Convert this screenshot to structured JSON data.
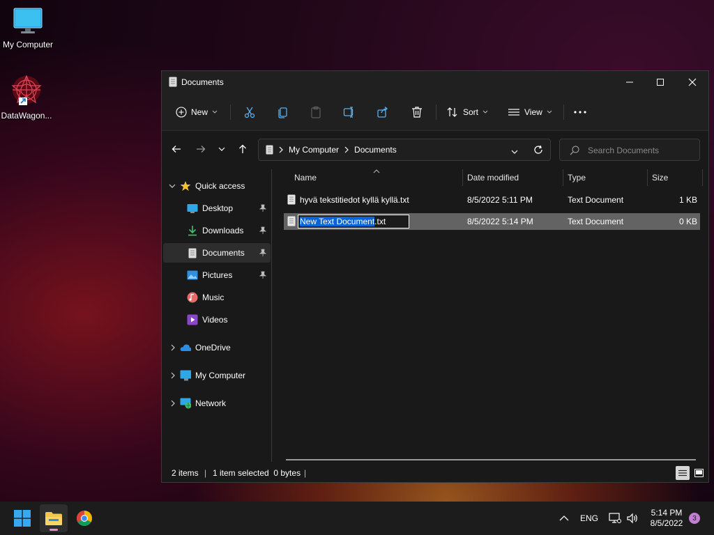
{
  "desktop": {
    "icons": [
      {
        "label": "My Computer",
        "icon": "monitor-icon"
      },
      {
        "label": "DataWagon...",
        "icon": "datawagon-shortcut-icon"
      }
    ]
  },
  "window": {
    "title": "Documents",
    "toolbar": {
      "new_label": "New",
      "sort_label": "Sort",
      "view_label": "View"
    },
    "address": {
      "crumbs": [
        "My Computer",
        "Documents"
      ]
    },
    "search": {
      "placeholder": "Search Documents"
    },
    "sidebar": {
      "quick_access": "Quick access",
      "items": [
        {
          "label": "Desktop",
          "pinned": true
        },
        {
          "label": "Downloads",
          "pinned": true
        },
        {
          "label": "Documents",
          "pinned": true,
          "selected": true
        },
        {
          "label": "Pictures",
          "pinned": true
        },
        {
          "label": "Music",
          "pinned": false
        },
        {
          "label": "Videos",
          "pinned": false
        }
      ],
      "roots": [
        "OneDrive",
        "My Computer",
        "Network"
      ]
    },
    "columns": [
      "Name",
      "Date modified",
      "Type",
      "Size"
    ],
    "files": [
      {
        "name": "hyvä tekstitiedot kyllä kyllä.txt",
        "date": "8/5/2022 5:11 PM",
        "type": "Text Document",
        "size": "1 KB"
      },
      {
        "name": "New Text Document.txt",
        "name_selected_part": "New Text Document",
        "name_ext": ".txt",
        "date": "8/5/2022 5:14 PM",
        "type": "Text Document",
        "size": "0 KB",
        "renaming": true
      }
    ],
    "status": {
      "items": "2 items",
      "selection": "1 item selected  0 bytes"
    }
  },
  "taskbar": {
    "language": "ENG",
    "time": "5:14 PM",
    "date": "8/5/2022",
    "notification_count": "3"
  },
  "colors": {
    "accent": "#0a64d8",
    "folder_yellow": "#f2c84b",
    "window_bg": "#191919",
    "selection_row": "#636363",
    "notification_badge": "#c27fd1"
  }
}
